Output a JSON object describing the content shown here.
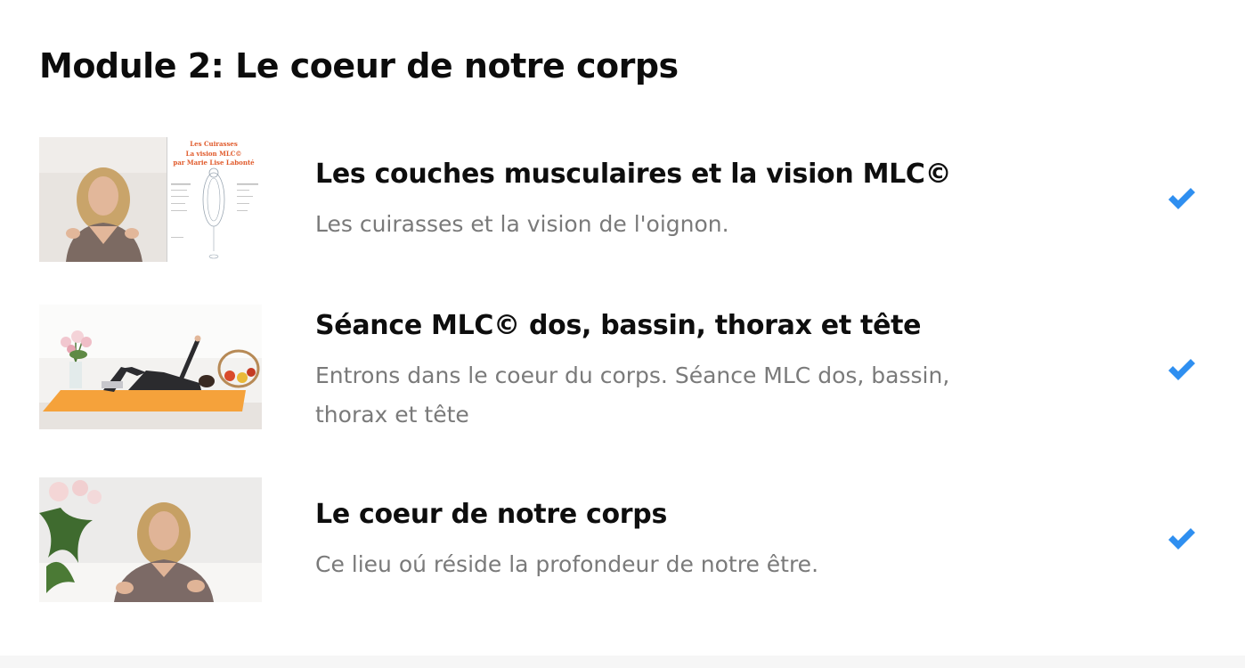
{
  "module": {
    "title": "Module 2: Le coeur de notre corps"
  },
  "lessons": [
    {
      "title": "Les couches musculaires et la vision MLC©",
      "description": "Les cuirasses et la vision de l'oignon.",
      "completed": true,
      "thumbnail_text": {
        "line1": "Les Cuirasses",
        "line2": "La vision MLC©",
        "line3": "par Marie Lise Labonté"
      }
    },
    {
      "title": "Séance MLC© dos, bassin, thorax et tête",
      "description": "Entrons dans le coeur du corps. Séance MLC dos, bassin, thorax et tête",
      "completed": true
    },
    {
      "title": "Le coeur de notre corps",
      "description": "Ce lieu oú réside la profondeur de notre être.",
      "completed": true
    }
  ],
  "icons": {
    "check": "check-icon"
  },
  "colors": {
    "check": "#2f8ff0",
    "title": "#0e0e0e",
    "description": "#7a7a7a",
    "thumbnail_text_accent": "#e05a2b"
  }
}
